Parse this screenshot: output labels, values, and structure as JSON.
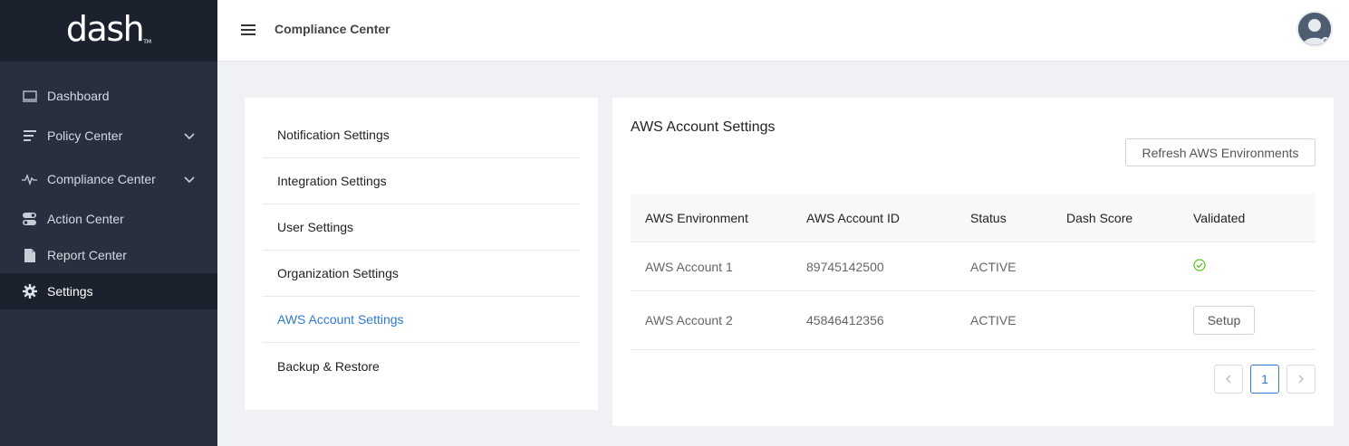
{
  "logo": {
    "text": "dash",
    "tm": "TM"
  },
  "sidebar": {
    "items": [
      {
        "label": "Dashboard",
        "icon": "monitor-icon"
      },
      {
        "label": "Policy Center",
        "icon": "list-icon"
      },
      {
        "label": "Compliance Center",
        "icon": "pulse-icon"
      },
      {
        "label": "Action Center",
        "icon": "toggle-icon"
      },
      {
        "label": "Report Center",
        "icon": "file-icon"
      },
      {
        "label": "Settings",
        "icon": "gear-icon"
      }
    ]
  },
  "header": {
    "title": "Compliance Center"
  },
  "settings_menu": {
    "items": [
      {
        "label": "Notification Settings"
      },
      {
        "label": "Integration Settings"
      },
      {
        "label": "User Settings"
      },
      {
        "label": "Organization Settings"
      },
      {
        "label": "AWS Account Settings"
      },
      {
        "label": "Backup & Restore"
      }
    ]
  },
  "aws": {
    "title": "AWS Account Settings",
    "refresh_label": "Refresh AWS Environments",
    "columns": [
      "AWS Environment",
      "AWS Account ID",
      "Status",
      "Dash Score",
      "Validated"
    ],
    "rows": [
      {
        "environment": "AWS Account 1",
        "account_id": "89745142500",
        "status": "ACTIVE",
        "dash_score": "",
        "validated": "check-circle-icon"
      },
      {
        "environment": "AWS Account 2",
        "account_id": "45846412356",
        "status": "ACTIVE",
        "dash_score": "",
        "validated_button": "Setup"
      }
    ],
    "pagination": {
      "current_page": "1",
      "prev_icon": "chevron-left-icon",
      "next_icon": "chevron-right-icon"
    }
  },
  "colors": {
    "sidebar_bg": "#283040",
    "sidebar_dark": "#1c222d",
    "accent": "#2f7ad6",
    "success": "#52c41a"
  }
}
